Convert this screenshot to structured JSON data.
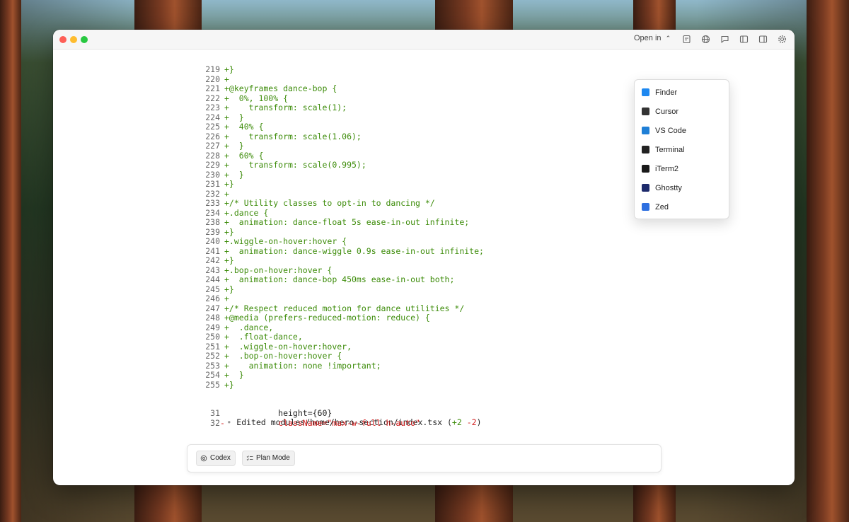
{
  "toolbar": {
    "open_in_label": "Open in"
  },
  "open_in_menu": {
    "items": [
      {
        "label": "Finder",
        "icon": "finder-icon",
        "color": "#1e88f0"
      },
      {
        "label": "Cursor",
        "icon": "cursor-icon",
        "color": "#333333"
      },
      {
        "label": "VS Code",
        "icon": "vscode-icon",
        "color": "#1f7fd6"
      },
      {
        "label": "Terminal",
        "icon": "terminal-icon",
        "color": "#222222"
      },
      {
        "label": "iTerm2",
        "icon": "iterm2-icon",
        "color": "#1a1a1a"
      },
      {
        "label": "Ghostty",
        "icon": "ghostty-icon",
        "color": "#1d2a6b"
      },
      {
        "label": "Zed",
        "icon": "zed-icon",
        "color": "#2d6fe0"
      }
    ]
  },
  "diff": {
    "lines": [
      {
        "n": "219",
        "text": "+}"
      },
      {
        "n": "220",
        "text": "+"
      },
      {
        "n": "221",
        "text": "+@keyframes dance-bop {"
      },
      {
        "n": "222",
        "text": "+  0%, 100% {"
      },
      {
        "n": "223",
        "text": "+    transform: scale(1);"
      },
      {
        "n": "224",
        "text": "+  }"
      },
      {
        "n": "225",
        "text": "+  40% {"
      },
      {
        "n": "226",
        "text": "+    transform: scale(1.06);"
      },
      {
        "n": "227",
        "text": "+  }"
      },
      {
        "n": "228",
        "text": "+  60% {"
      },
      {
        "n": "229",
        "text": "+    transform: scale(0.995);"
      },
      {
        "n": "230",
        "text": "+  }"
      },
      {
        "n": "231",
        "text": "+}"
      },
      {
        "n": "232",
        "text": "+"
      },
      {
        "n": "233",
        "text": "+/* Utility classes to opt-in to dancing */"
      },
      {
        "n": "234",
        "text": "+.dance {"
      },
      {
        "n": "238",
        "text": "+  animation: dance-float 5s ease-in-out infinite;"
      },
      {
        "n": "239",
        "text": "+}"
      },
      {
        "n": "240",
        "text": "+.wiggle-on-hover:hover {"
      },
      {
        "n": "241",
        "text": "+  animation: dance-wiggle 0.9s ease-in-out infinite;"
      },
      {
        "n": "242",
        "text": "+}"
      },
      {
        "n": "243",
        "text": "+.bop-on-hover:hover {"
      },
      {
        "n": "244",
        "text": "+  animation: dance-bop 450ms ease-in-out both;"
      },
      {
        "n": "245",
        "text": "+}"
      },
      {
        "n": "246",
        "text": "+"
      },
      {
        "n": "247",
        "text": "+/* Respect reduced motion for dance utilities */"
      },
      {
        "n": "248",
        "text": "+@media (prefers-reduced-motion: reduce) {"
      },
      {
        "n": "249",
        "text": "+  .dance,"
      },
      {
        "n": "250",
        "text": "+  .float-dance,"
      },
      {
        "n": "251",
        "text": "+  .wiggle-on-hover:hover,"
      },
      {
        "n": "252",
        "text": "+  .bop-on-hover:hover {"
      },
      {
        "n": "253",
        "text": "+    animation: none !important;"
      },
      {
        "n": "254",
        "text": "+  }"
      },
      {
        "n": "255",
        "text": "+}"
      }
    ],
    "edited": {
      "bullet": "•",
      "prefix": "Edited modules/home/hero-section/index.tsx (",
      "added": "+2",
      "removed": "-2",
      "suffix": ")"
    },
    "second_lines": [
      {
        "n": "31",
        "marker": "",
        "text": "           height={60}",
        "kind": "ctx"
      },
      {
        "n": "32",
        "marker": "-",
        "text": "           className=\"max-w-full h-auto\"",
        "kind": "del"
      }
    ]
  },
  "composer": {
    "codex_label": "Codex",
    "plan_label": "Plan Mode"
  }
}
